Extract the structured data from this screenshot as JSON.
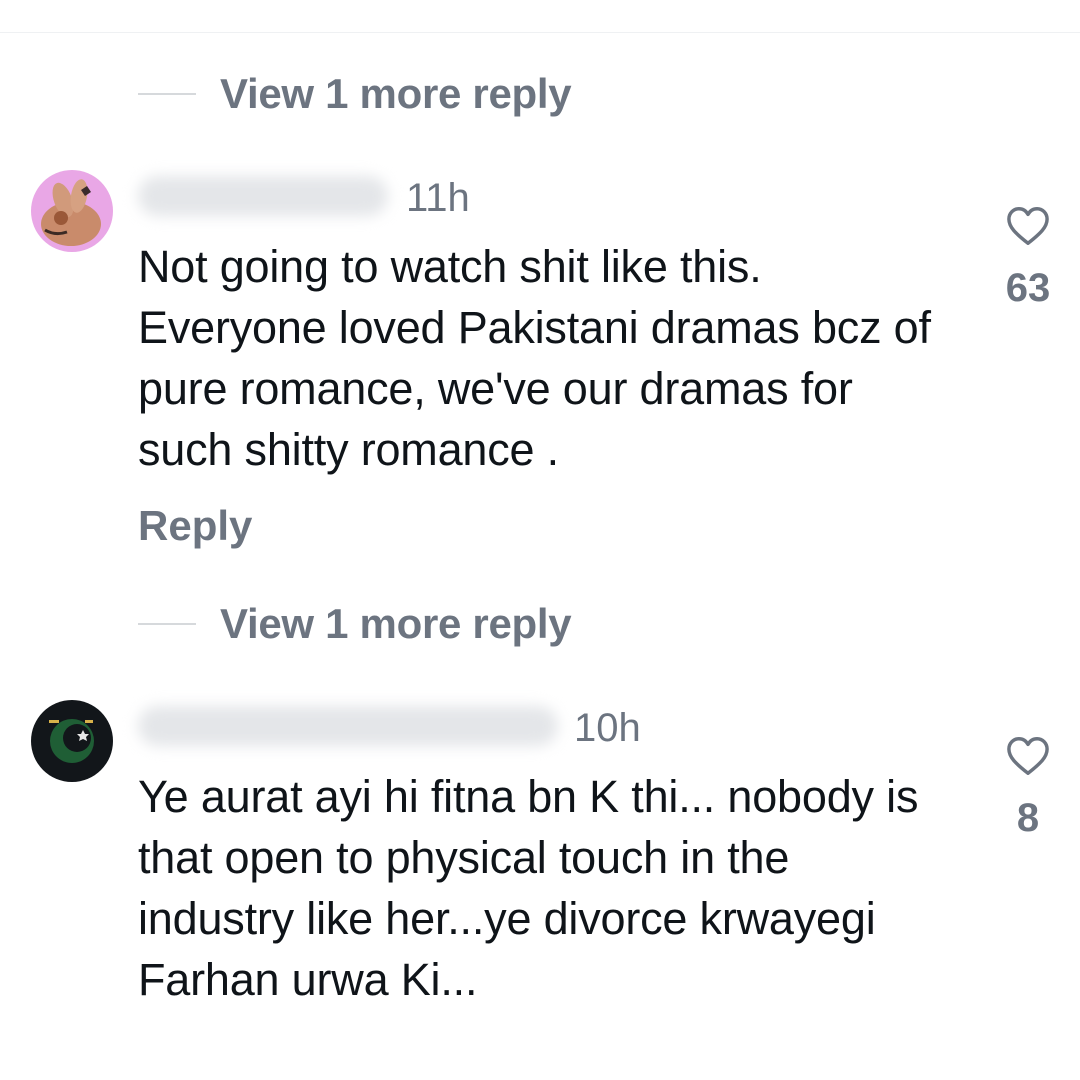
{
  "thread": {
    "view_more_label_1": "View 1 more reply",
    "view_more_label_2": "View 1 more reply"
  },
  "comments": [
    {
      "time": "11h",
      "text": "Not going to watch shit like this. Everyone loved Pakistani dramas bcz of pure romance, we've our dramas for such shitty romance .",
      "reply_label": "Reply",
      "likes": "63"
    },
    {
      "time": "10h",
      "text": "Ye aurat ayi hi fitna bn K thi... nobody is that open to physical touch in the industry like her...ye divorce krwayegi Farhan urwa Ki...",
      "likes": "8"
    }
  ],
  "icons": {
    "like": "heart-outline-icon",
    "avatar_1": "hand-avatar",
    "avatar_2": "flag-avatar"
  },
  "colors": {
    "text": "#0f1419",
    "secondary": "#6c7480",
    "divider": "#d6d9dc"
  }
}
